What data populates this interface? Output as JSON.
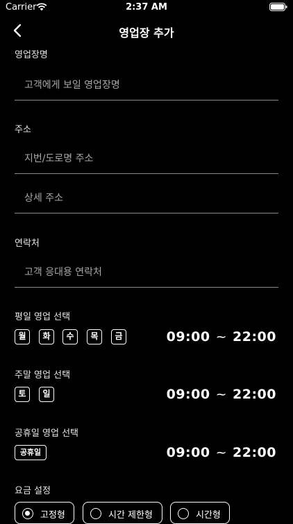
{
  "status_bar": {
    "carrier": "Carrier",
    "time": "2:37 AM"
  },
  "nav": {
    "title": "영업장 추가"
  },
  "business_name": {
    "label": "영업장명",
    "placeholder": "고객에게 보일 영업장명"
  },
  "address": {
    "label": "주소",
    "street_placeholder": "지번/도로명 주소",
    "detail_placeholder": "상세 주소"
  },
  "contact": {
    "label": "연락처",
    "placeholder": "고객 응대용 연락처"
  },
  "weekday": {
    "label": "평일 영업 선택",
    "days": [
      "월",
      "화",
      "수",
      "목",
      "금"
    ],
    "open": "09:00",
    "sep": "~",
    "close": "22:00"
  },
  "weekend": {
    "label": "주말 영업 선택",
    "days": [
      "토",
      "일"
    ],
    "open": "09:00",
    "sep": "~",
    "close": "22:00"
  },
  "holiday": {
    "label": "공휴일 영업 선택",
    "chip": "공휴일",
    "open": "09:00",
    "sep": "~",
    "close": "22:00"
  },
  "rate": {
    "label": "요금 설정",
    "options": [
      "고정형",
      "시간 제한형",
      "시간형"
    ],
    "selected": "고정형"
  }
}
